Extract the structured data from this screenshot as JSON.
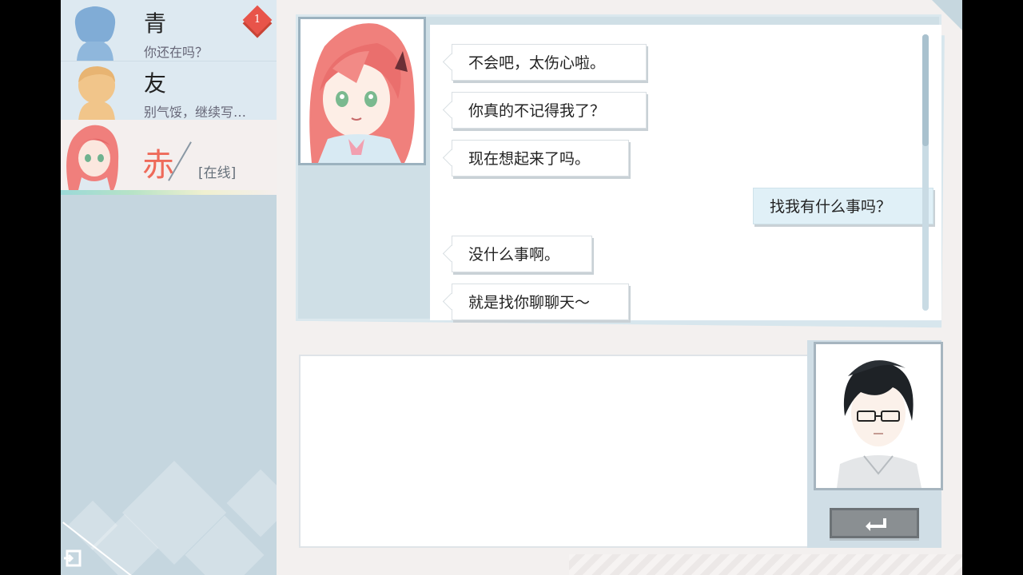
{
  "contacts": [
    {
      "name": "青",
      "preview": "你还在吗？",
      "unread": "1"
    },
    {
      "name": "友",
      "preview": "别气馁，继续写…"
    },
    {
      "name": "赤",
      "status": "[在线]"
    }
  ],
  "messages": [
    {
      "side": "left",
      "text": "不会吧，太伤心啦。"
    },
    {
      "side": "left",
      "text": "你真的不记得我了？"
    },
    {
      "side": "left",
      "text": "现在想起来了吗。"
    },
    {
      "side": "right",
      "text": "找我有什么事吗？"
    },
    {
      "side": "left",
      "text": "没什么事啊。"
    },
    {
      "side": "left",
      "text": "就是找你聊聊天～"
    }
  ],
  "input": {
    "value": ""
  },
  "colors": {
    "accent_red": "#ee6a5a",
    "badge": "#e8544a",
    "panel_blue": "#cfdfe6",
    "sidebar": "#c5d6df"
  },
  "icons": {
    "exit": "exit-door-icon",
    "send": "enter-return-icon"
  }
}
